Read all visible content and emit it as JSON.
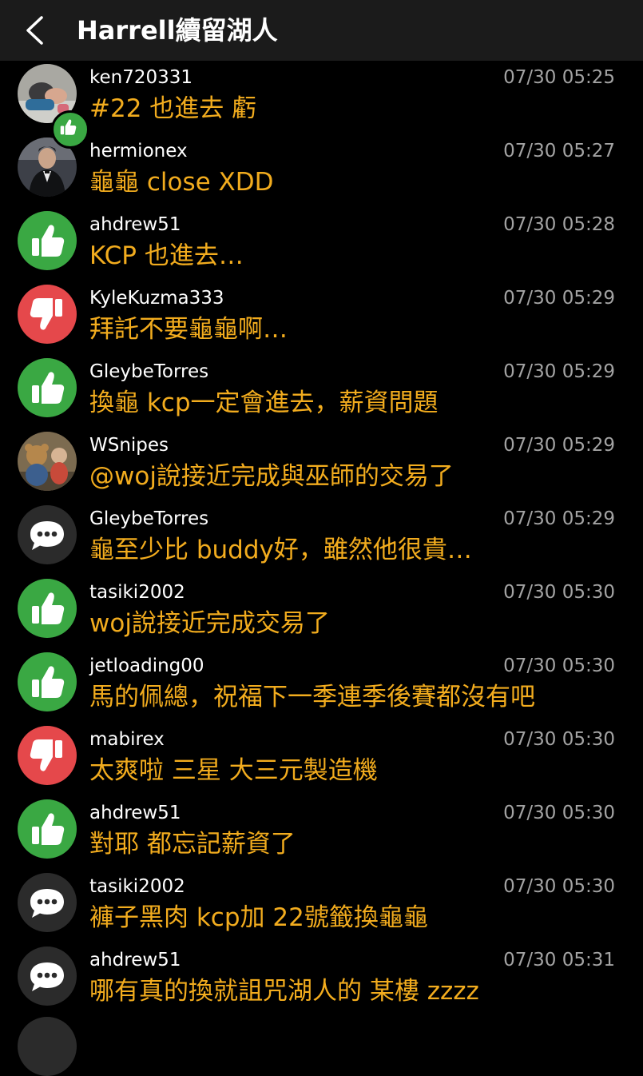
{
  "header": {
    "title": "Harrell續留湖人"
  },
  "colors": {
    "like": "#3aa843",
    "dislike": "#e5484b",
    "neutral": "#2b2b2b",
    "message": "#f2ac1e",
    "time": "#a3a3a3"
  },
  "comments": [
    {
      "user": "ken720331",
      "time": "07/30 05:25",
      "text": "#22 也進去  虧",
      "icon": "photo-avatar-child"
    },
    {
      "user": "hermionex",
      "time": "07/30 05:27",
      "text": "龜龜 close XDD",
      "icon": "photo-avatar-suit"
    },
    {
      "user": "ahdrew51",
      "time": "07/30 05:28",
      "text": "KCP 也進去…",
      "icon": "thumbs-up-icon"
    },
    {
      "user": "KyleKuzma333",
      "time": "07/30 05:29",
      "text": "拜託不要龜龜啊…",
      "icon": "thumbs-down-icon"
    },
    {
      "user": "GleybeTorres",
      "time": "07/30 05:29",
      "text": "換龜 kcp一定會進去，薪資問題",
      "icon": "thumbs-up-icon"
    },
    {
      "user": "WSnipes",
      "time": "07/30 05:29",
      "text": "@woj說接近完成與巫師的交易了",
      "icon": "photo-avatar-toys"
    },
    {
      "user": "GleybeTorres",
      "time": "07/30 05:29",
      "text": "龜至少比 buddy好，雖然他很貴…",
      "icon": "comment-icon"
    },
    {
      "user": "tasiki2002",
      "time": "07/30 05:30",
      "text": "woj說接近完成交易了",
      "icon": "thumbs-up-icon"
    },
    {
      "user": "jetloading00",
      "time": "07/30 05:30",
      "text": "馬的佩總，祝福下一季連季後賽都沒有吧",
      "icon": "thumbs-up-icon"
    },
    {
      "user": "mabirex",
      "time": "07/30 05:30",
      "text": "太爽啦 三星 大三元製造機",
      "icon": "thumbs-down-icon"
    },
    {
      "user": "ahdrew51",
      "time": "07/30 05:30",
      "text": "對耶 都忘記薪資了",
      "icon": "thumbs-up-icon"
    },
    {
      "user": "tasiki2002",
      "time": "07/30 05:30",
      "text": "褲子黑肉 kcp加 22號籤換龜龜",
      "icon": "comment-icon"
    },
    {
      "user": "ahdrew51",
      "time": "07/30 05:31",
      "text": "哪有真的換就詛咒湖人的 某樓 zzzz",
      "icon": "comment-icon"
    }
  ]
}
